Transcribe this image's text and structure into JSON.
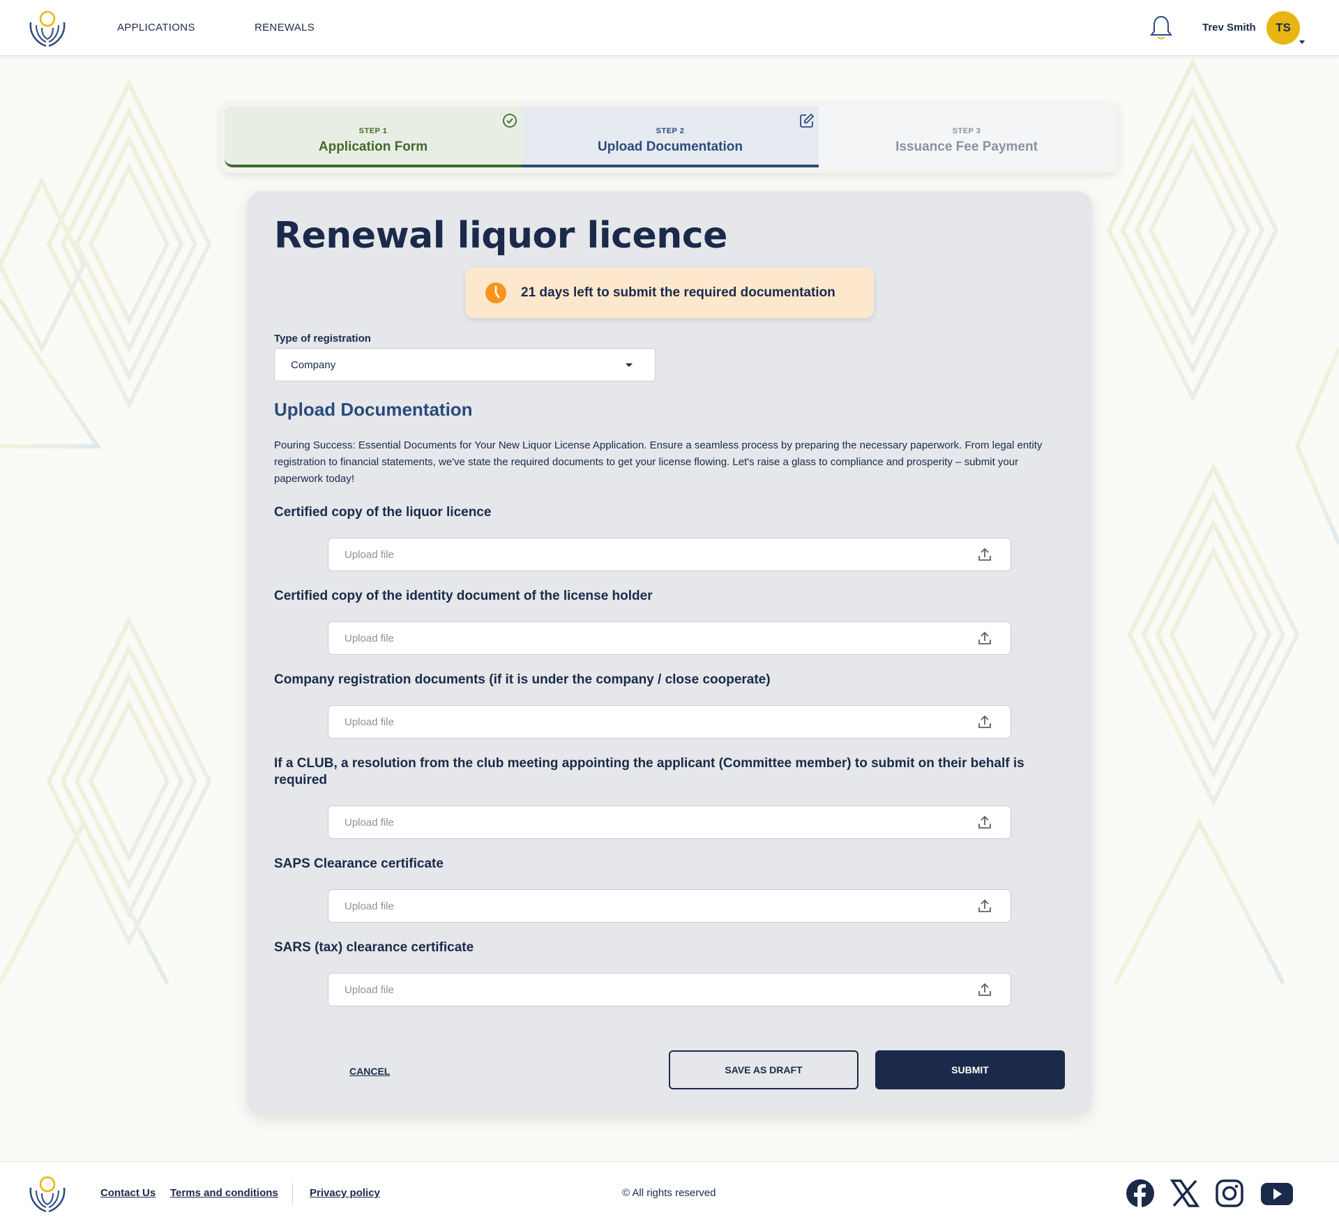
{
  "header": {
    "nav": [
      "APPLICATIONS",
      "RENEWALS"
    ],
    "user_name": "Trev Smith",
    "user_initials": "TS"
  },
  "steps": [
    {
      "number": "STEP 1",
      "title": "Application Form",
      "status": "complete"
    },
    {
      "number": "STEP 2",
      "title": "Upload Documentation",
      "status": "current"
    },
    {
      "number": "STEP 3",
      "title": "Issuance Fee Payment",
      "status": "upcoming"
    }
  ],
  "form": {
    "title": "Renewal liquor licence",
    "deadline_text": "21 days left to submit the required documentation",
    "registration_label": "Type of registration",
    "registration_value": "Company",
    "section_title": "Upload Documentation",
    "intro": "Pouring Success: Essential Documents for Your New Liquor License Application. Ensure a seamless process by preparing the necessary paperwork. From legal entity registration to financial statements, we've state the required documents to get your license flowing. Let's raise a glass to compliance and prosperity – submit your paperwork today!",
    "upload_placeholder": "Upload file",
    "documents": [
      "Certified copy of the liquor licence",
      "Certified copy of the identity document of the license holder",
      "Company registration documents (if it is under the company / close cooperate)",
      "If a CLUB, a resolution from the club meeting appointing the applicant (Committee member) to submit on their behalf is required",
      "SAPS Clearance certificate",
      "SARS (tax) clearance certificate"
    ],
    "cancel_label": "CANCEL",
    "draft_label": "SAVE AS DRAFT",
    "submit_label": "SUBMIT"
  },
  "footer": {
    "links": [
      "Contact Us",
      "Terms and conditions",
      "Privacy policy"
    ],
    "copyright": "© All rights reserved",
    "social": [
      "facebook-icon",
      "x-icon",
      "instagram-icon",
      "youtube-icon"
    ]
  },
  "colors": {
    "navy": "#1b2a4a",
    "accent_blue": "#2b4a7c",
    "green": "#3e6a2c",
    "yellow": "#e8b613",
    "orange": "#f7941d",
    "banner": "#fde8cd"
  }
}
